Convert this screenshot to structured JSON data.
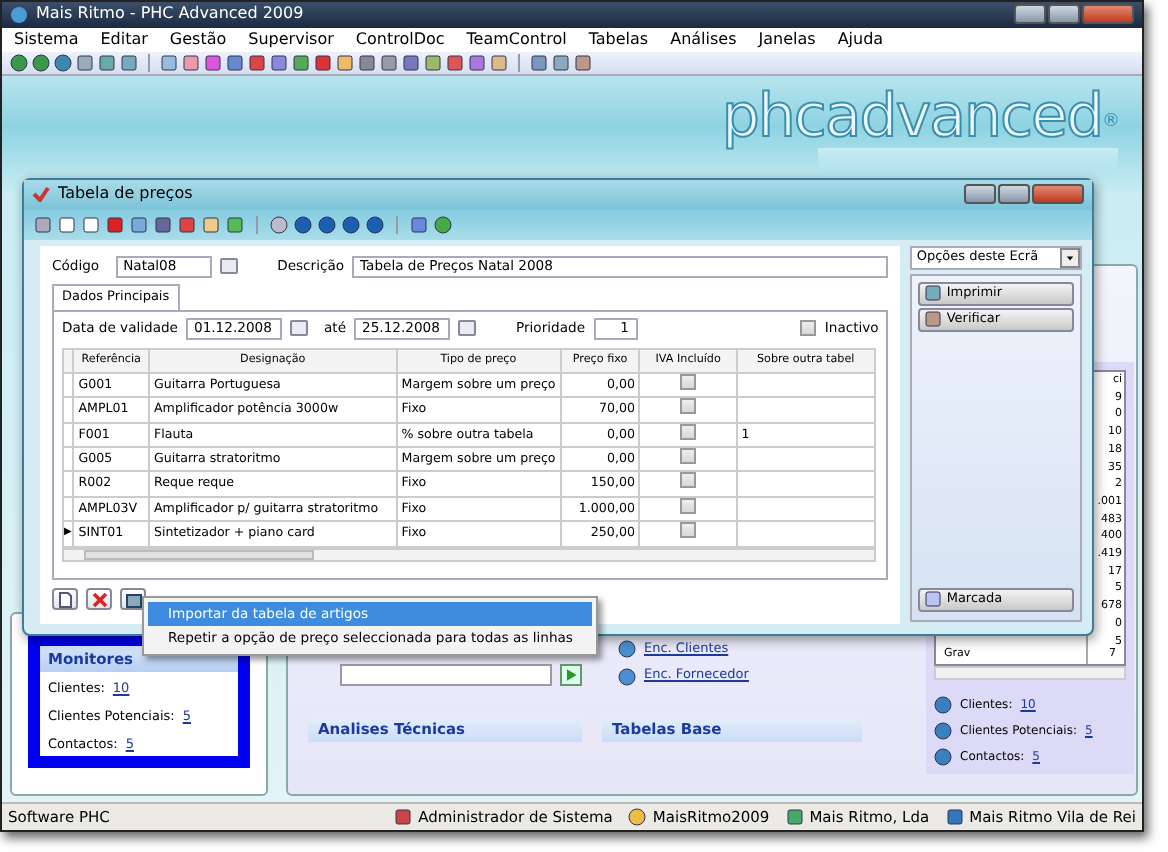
{
  "window": {
    "title": "Mais Ritmo - PHC Advanced 2009"
  },
  "menu": [
    {
      "label": "Sistema"
    },
    {
      "label": "Editar"
    },
    {
      "label": "Gestão"
    },
    {
      "label": "Supervisor"
    },
    {
      "label": "ControlDoc"
    },
    {
      "label": "TeamControl"
    },
    {
      "label": "Tabelas"
    },
    {
      "label": "Análises"
    },
    {
      "label": "Janelas"
    },
    {
      "label": "Ajuda"
    }
  ],
  "logo": {
    "text": "phcadvanced",
    "mark": "®"
  },
  "dialog": {
    "title": "Tabela de preços",
    "code": {
      "label": "Código",
      "value": "Natal08"
    },
    "description": {
      "label": "Descrição",
      "value": "Tabela de Preços Natal 2008"
    },
    "options_dropdown": "Opções deste Ecrã",
    "tabs": [
      {
        "label": "Dados Principais",
        "selected": true
      }
    ],
    "validity": {
      "label": "Data de validade",
      "from": "01.12.2008",
      "to_label": "até",
      "to": "25.12.2008"
    },
    "priority": {
      "label": "Prioridade",
      "value": "1"
    },
    "inactive": {
      "label": "Inactivo",
      "checked": false
    },
    "table": {
      "row_pointer": "▶",
      "columns": [
        "Referência",
        "Designação",
        "Tipo de preço",
        "Preço fixo",
        "IVA Incluído",
        "Sobre outra tabel"
      ],
      "rows": [
        {
          "ref": "G001",
          "name": "Guitarra Portuguesa",
          "type": "Margem sobre um preço",
          "price": "0,00",
          "vat_included": false,
          "other": "",
          "selected": false
        },
        {
          "ref": "AMPL01",
          "name": "Amplificador potência 3000w",
          "type": "Fixo",
          "price": "70,00",
          "vat_included": false,
          "other": "",
          "selected": false
        },
        {
          "ref": "F001",
          "name": "Flauta",
          "type": "% sobre outra tabela",
          "price": "0,00",
          "vat_included": false,
          "other": "1",
          "selected": false
        },
        {
          "ref": "G005",
          "name": "Guitarra stratoritmo",
          "type": "Margem sobre um preço",
          "price": "0,00",
          "vat_included": false,
          "other": "",
          "selected": false
        },
        {
          "ref": "R002",
          "name": "Reque reque",
          "type": "Fixo",
          "price": "150,00",
          "vat_included": false,
          "other": "",
          "selected": false
        },
        {
          "ref": "AMPL03V",
          "name": "Amplificador p/ guitarra stratoritmo",
          "type": "Fixo",
          "price": "1.000,00",
          "vat_included": false,
          "other": "",
          "selected": false
        },
        {
          "ref": "SINT01",
          "name": "Sintetizador  + piano card",
          "type": "Fixo",
          "price": "250,00",
          "vat_included": false,
          "other": "",
          "selected": true
        }
      ]
    },
    "side_buttons": [
      "Imprimir",
      "Verificar"
    ],
    "bottom_side_button": "Marcada"
  },
  "context_menu": [
    {
      "label": "Importar da tabela de artigos",
      "selected": true
    },
    {
      "label": "Repetir a opção de preço seleccionada para todas as linhas",
      "selected": false
    }
  ],
  "monitors": {
    "title": "Monitores",
    "items": [
      {
        "label": "Clientes:",
        "value": "10"
      },
      {
        "label": "Clientes Potenciais:",
        "value": "5"
      },
      {
        "label": "Contactos:",
        "value": "5"
      }
    ]
  },
  "links": [
    "Enc. Clientes",
    "Enc. Fornecedor"
  ],
  "sections": [
    "Analises Técnicas",
    "Tabelas Base"
  ],
  "mini_table": {
    "header": "ci",
    "values": [
      "9",
      "0",
      "10",
      "18",
      "35",
      "2",
      ".001",
      "483",
      "400",
      ".419",
      "17",
      "5",
      "678",
      "0",
      "5"
    ],
    "last_row": {
      "label": "Grav",
      "value": "7"
    }
  },
  "summary": [
    {
      "label": "Clientes:",
      "value": "10"
    },
    {
      "label": "Clientes Potenciais:",
      "value": "5"
    },
    {
      "label": "Contactos:",
      "value": "5"
    }
  ],
  "status_bar": [
    {
      "text": "Software PHC"
    },
    {
      "text": "Administrador de Sistema"
    },
    {
      "text": "MaisRitmo2009"
    },
    {
      "text": "Mais Ritmo, Lda"
    },
    {
      "text": "Mais Ritmo Vila de Rei"
    }
  ]
}
